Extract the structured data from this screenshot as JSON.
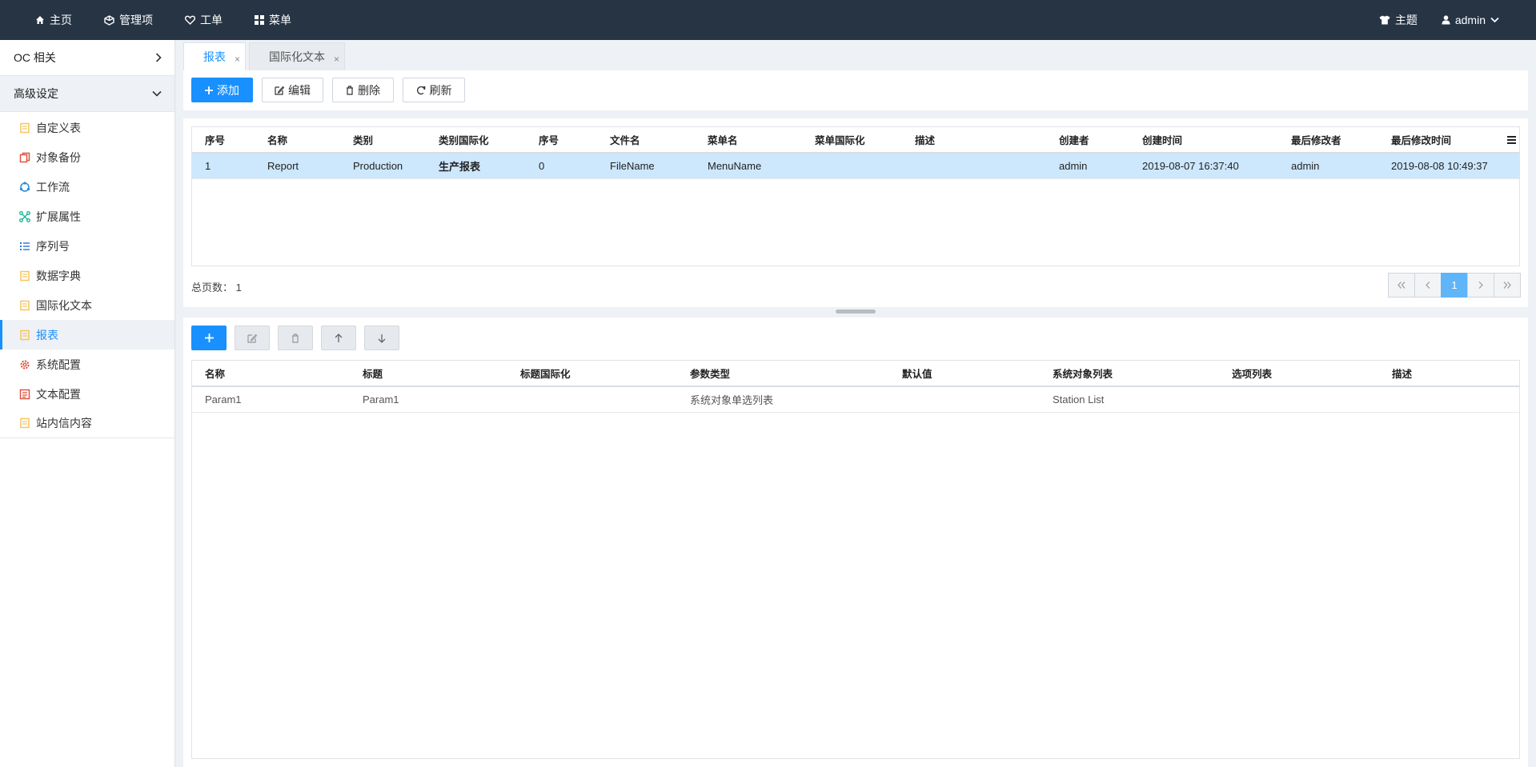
{
  "topnav": [
    {
      "label": "主页",
      "icon": "home-icon"
    },
    {
      "label": "管理项",
      "icon": "cube-icon"
    },
    {
      "label": "工单",
      "icon": "heart-icon"
    },
    {
      "label": "菜单",
      "icon": "grid-icon"
    }
  ],
  "topright": {
    "theme": "主题",
    "user": "admin"
  },
  "sidebar": {
    "groups": [
      {
        "label": "OC 相关"
      },
      {
        "label": "高级设定"
      }
    ],
    "items": [
      {
        "label": "自定义表",
        "icon": "folder-icon",
        "color": "#f7c55b"
      },
      {
        "label": "对象备份",
        "icon": "copy-icon",
        "color": "#e2533f"
      },
      {
        "label": "工作流",
        "icon": "sync-icon",
        "color": "#2c8bd8"
      },
      {
        "label": "扩展属性",
        "icon": "nodes-icon",
        "color": "#1bb394"
      },
      {
        "label": "序列号",
        "icon": "list-icon",
        "color": "#2c6fd8"
      },
      {
        "label": "数据字典",
        "icon": "folder-icon",
        "color": "#f7c55b"
      },
      {
        "label": "国际化文本",
        "icon": "folder-icon",
        "color": "#f7c55b"
      },
      {
        "label": "报表",
        "icon": "folder-icon",
        "color": "#f7c55b"
      },
      {
        "label": "系统配置",
        "icon": "gear-icon",
        "color": "#e2533f"
      },
      {
        "label": "文本配置",
        "icon": "doc-icon",
        "color": "#e2533f"
      },
      {
        "label": "站内信内容",
        "icon": "folder-icon",
        "color": "#f7c55b"
      }
    ]
  },
  "tabs": [
    {
      "label": "报表",
      "close": "×"
    },
    {
      "label": "国际化文本",
      "close": "×"
    }
  ],
  "toolbar": {
    "add": "添加",
    "edit": "编辑",
    "delete": "删除",
    "refresh": "刷新"
  },
  "grid1": {
    "columns": [
      "序号",
      "名称",
      "类别",
      "类别国际化",
      "序号",
      "文件名",
      "菜单名",
      "菜单国际化",
      "描述",
      "创建者",
      "创建时间",
      "最后修改者",
      "最后修改时间"
    ],
    "rows": [
      [
        "1",
        "Report",
        "Production",
        "生产报表",
        "0",
        "FileName",
        "MenuName",
        "",
        "",
        "admin",
        "2019-08-07 16:37:40",
        "admin",
        "2019-08-08 10:49:37"
      ]
    ]
  },
  "pager": {
    "total_label": "总页数：",
    "total": "1",
    "current": "1"
  },
  "grid2": {
    "columns": [
      "名称",
      "标题",
      "标题国际化",
      "参数类型",
      "默认值",
      "系统对象列表",
      "选项列表",
      "描述"
    ],
    "rows": [
      [
        "Param1",
        "Param1",
        "",
        "系统对象单选列表",
        "",
        "Station List",
        "",
        ""
      ]
    ]
  }
}
